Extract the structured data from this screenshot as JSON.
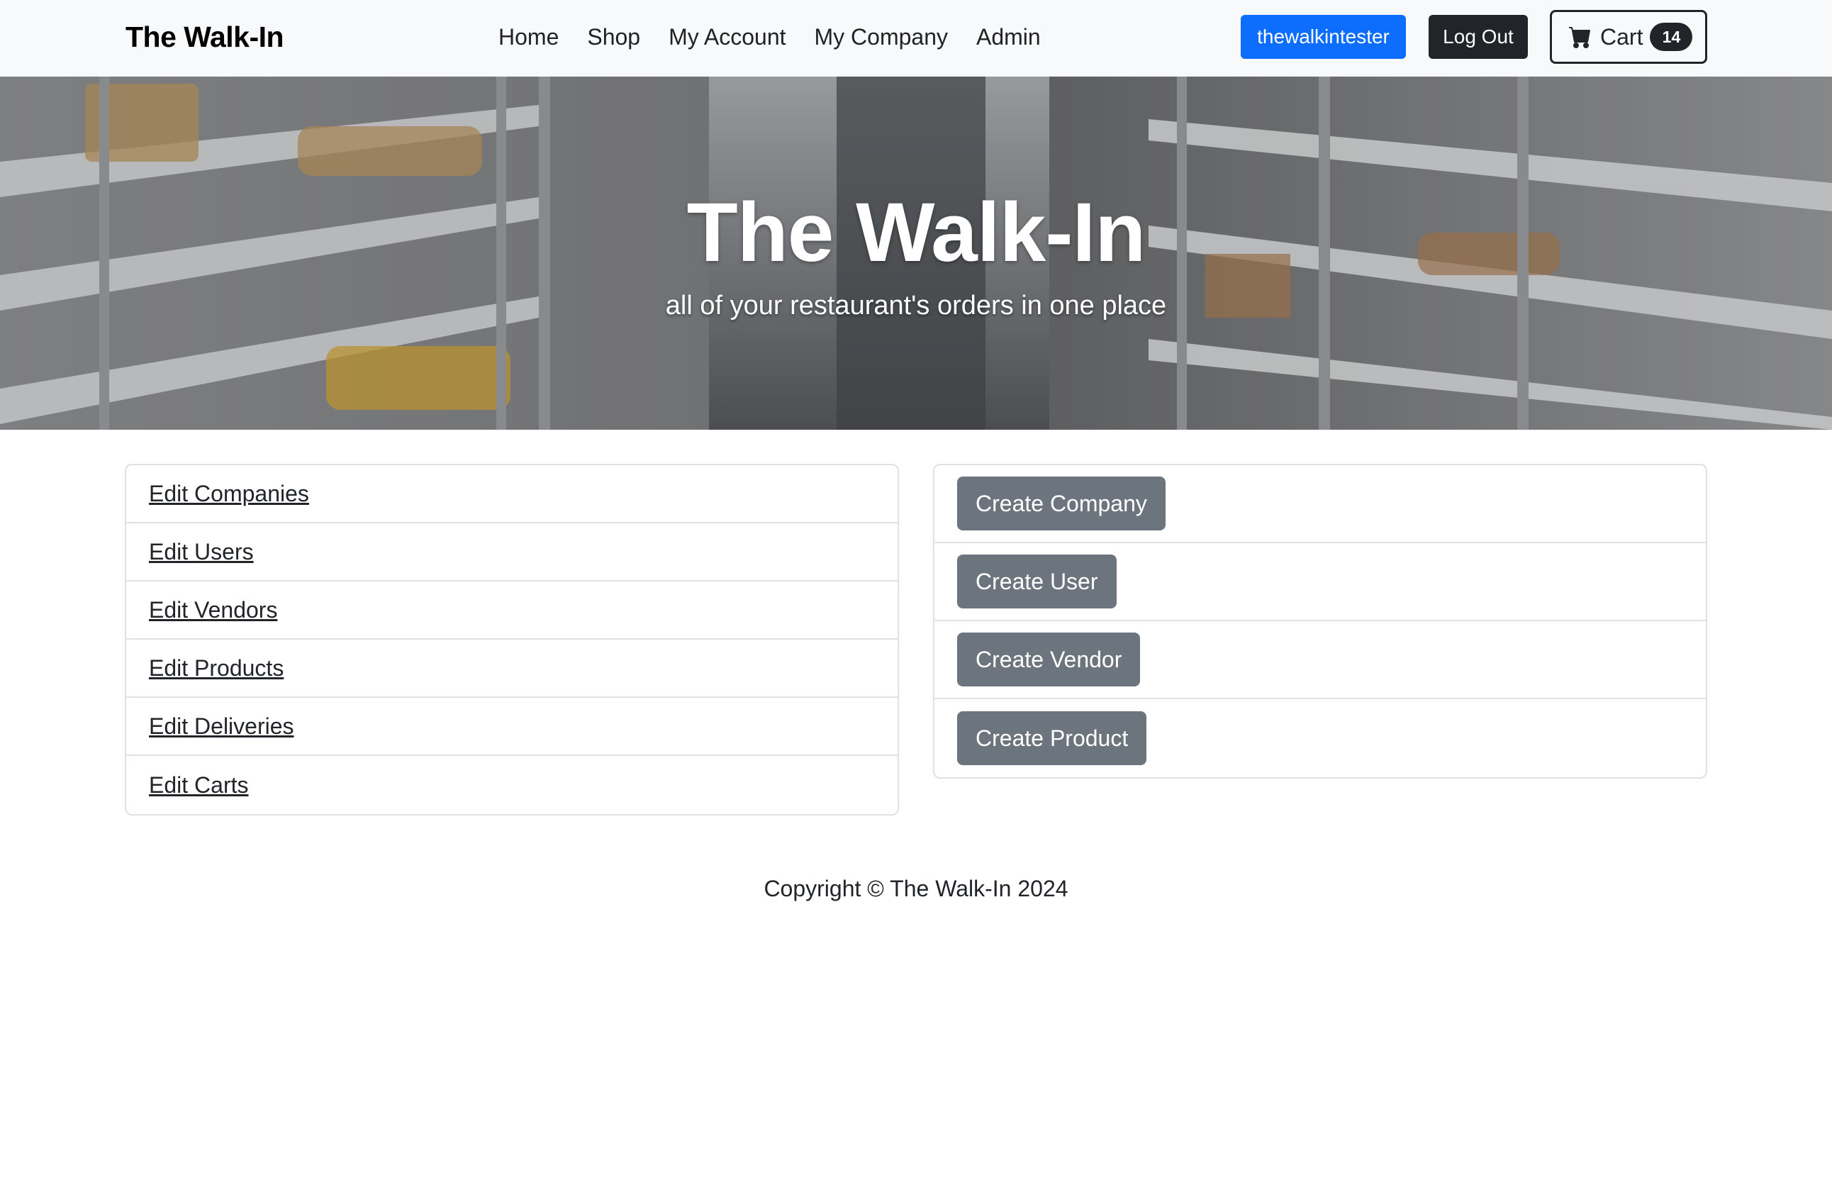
{
  "navbar": {
    "brand": "The Walk-In",
    "links": [
      "Home",
      "Shop",
      "My Account",
      "My Company",
      "Admin"
    ],
    "user_button": "thewalkintester",
    "logout_button": "Log Out",
    "cart_label": "Cart",
    "cart_count": "14"
  },
  "hero": {
    "title": "The Walk-In",
    "subtitle": "all of your restaurant's orders in one place"
  },
  "edit_links": [
    "Edit Companies",
    "Edit Users",
    "Edit Vendors",
    "Edit Products",
    "Edit Deliveries",
    "Edit Carts"
  ],
  "create_buttons": [
    "Create Company",
    "Create User",
    "Create Vendor",
    "Create Product"
  ],
  "footer": {
    "copyright": "Copyright © The Walk-In 2024"
  },
  "colors": {
    "primary": "#0d6efd",
    "dark": "#212529",
    "secondary": "#6c757d",
    "navbar_bg": "#f8f9fa"
  },
  "icons": {
    "cart": "cart-icon"
  }
}
